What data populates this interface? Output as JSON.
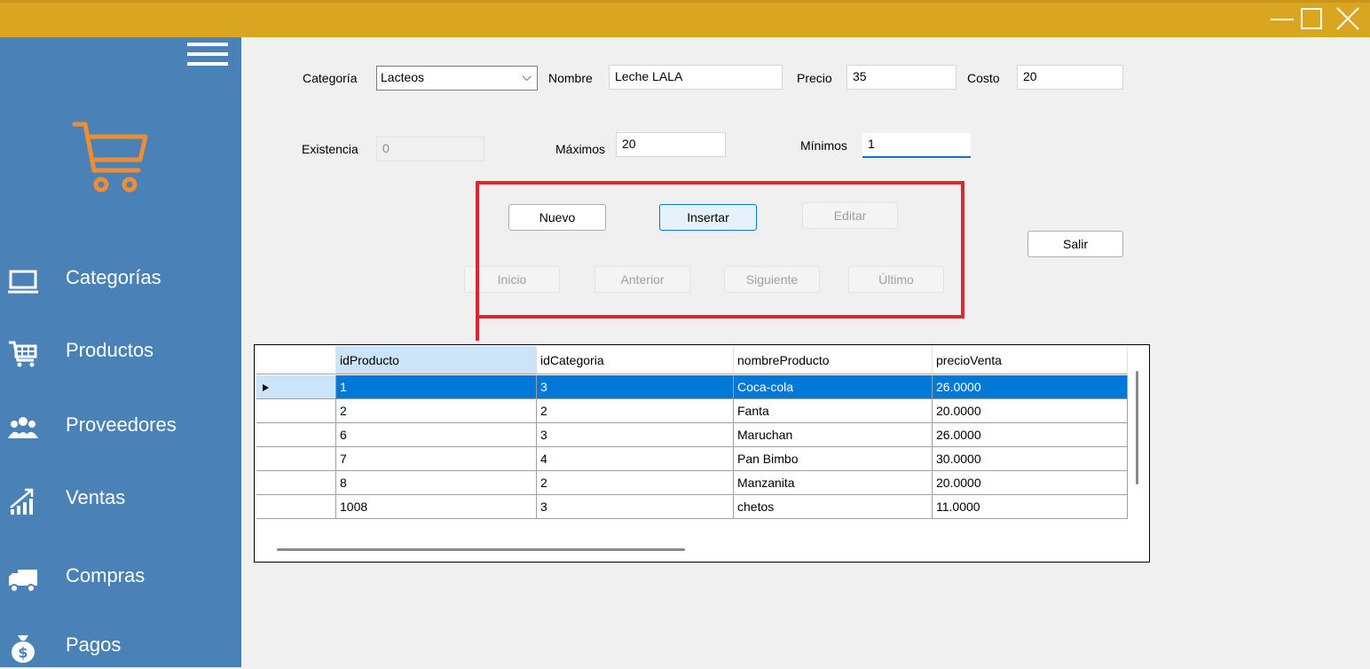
{
  "window": {
    "controls": [
      "minimize-icon",
      "maximize-icon",
      "close-icon"
    ],
    "titlebar_color": "#daa520"
  },
  "sidebar": {
    "color": "#4a82b8",
    "logo_icon": "shopping-cart-icon",
    "items": [
      {
        "label": "Categorías",
        "icon": "laptop-icon"
      },
      {
        "label": "Productos",
        "icon": "cart-icon"
      },
      {
        "label": "Proveedores",
        "icon": "users-icon"
      },
      {
        "label": "Ventas",
        "icon": "chart-icon"
      },
      {
        "label": "Compras",
        "icon": "truck-icon"
      },
      {
        "label": "Pagos",
        "icon": "money-bag-icon"
      }
    ]
  },
  "form": {
    "categoria_label": "Categoría",
    "categoria_value": "Lacteos",
    "nombre_label": "Nombre",
    "nombre_value": "Leche LALA",
    "precio_label": "Precio",
    "precio_value": "35",
    "costo_label": "Costo",
    "costo_value": "20",
    "existencia_label": "Existencia",
    "existencia_value": "0",
    "maximos_label": "Máximos",
    "maximos_value": "20",
    "minimos_label": "Mínimos",
    "minimos_value": "1"
  },
  "buttons": {
    "nuevo": "Nuevo",
    "insertar": "Insertar",
    "editar": "Editar",
    "salir": "Salir",
    "inicio": "Inicio",
    "anterior": "Anterior",
    "siguiente": "Siguiente",
    "ultimo": "Último"
  },
  "table": {
    "columns": [
      "idProducto",
      "idCategoria",
      "nombreProducto",
      "precioVenta"
    ],
    "rows": [
      [
        "1",
        "3",
        "Coca-cola",
        "26.0000"
      ],
      [
        "2",
        "2",
        "Fanta",
        "20.0000"
      ],
      [
        "6",
        "3",
        "Maruchan",
        "26.0000"
      ],
      [
        "7",
        "4",
        "Pan Bimbo",
        "30.0000"
      ],
      [
        "8",
        "2",
        "Manzanita",
        "20.0000"
      ],
      [
        "1008",
        "3",
        "chetos",
        "11.0000"
      ]
    ],
    "selected_row": 0
  }
}
